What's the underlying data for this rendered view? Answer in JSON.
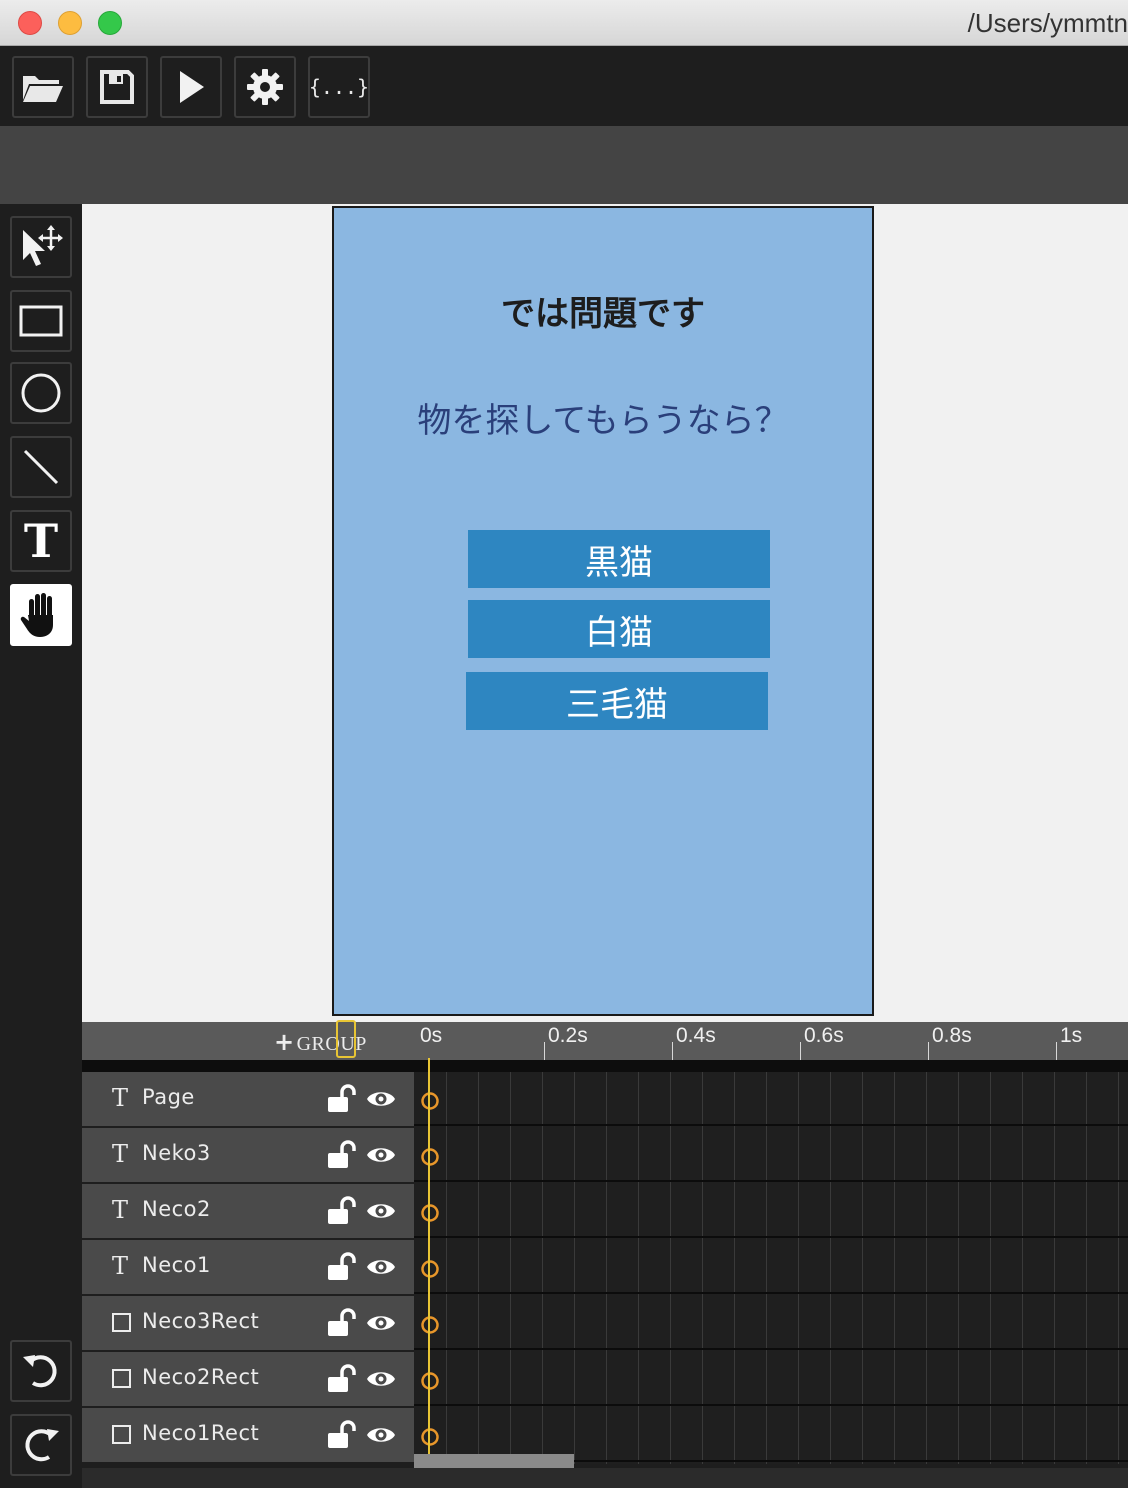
{
  "window": {
    "title": "/Users/ymmtn"
  },
  "toolbar": {
    "open_icon": "folder-open-icon",
    "save_icon": "save-icon",
    "play_icon": "play-icon",
    "settings_icon": "gear-icon",
    "code_label": "{...}"
  },
  "tools": [
    "select-move-icon",
    "rectangle-icon",
    "ellipse-icon",
    "line-icon",
    "text-icon",
    "hand-icon"
  ],
  "tools_text_label": "T",
  "active_tool": "hand-icon",
  "history": [
    "undo-icon",
    "redo-icon"
  ],
  "page": {
    "title": "では問題です",
    "question": "物を探してもらうなら？",
    "choices": [
      "黒猫",
      "白猫",
      "三毛猫"
    ],
    "background": "#8bb7e1",
    "choice_color": "#2e86c1"
  },
  "timeline": {
    "group_label": "GROUP",
    "ticks": [
      "0s",
      "0.2s",
      "0.4s",
      "0.6s",
      "0.8s",
      "1s"
    ],
    "playhead_time": "0s",
    "layers": [
      {
        "type": "text",
        "name": "Page"
      },
      {
        "type": "text",
        "name": "Neko3"
      },
      {
        "type": "text",
        "name": "Neco2"
      },
      {
        "type": "text",
        "name": "Neco1"
      },
      {
        "type": "rect",
        "name": "Neco3Rect"
      },
      {
        "type": "rect",
        "name": "Neco2Rect"
      },
      {
        "type": "rect",
        "name": "Neco1Rect"
      }
    ],
    "keyframe_color": "#e8962a",
    "playhead_color": "#e8c534"
  }
}
